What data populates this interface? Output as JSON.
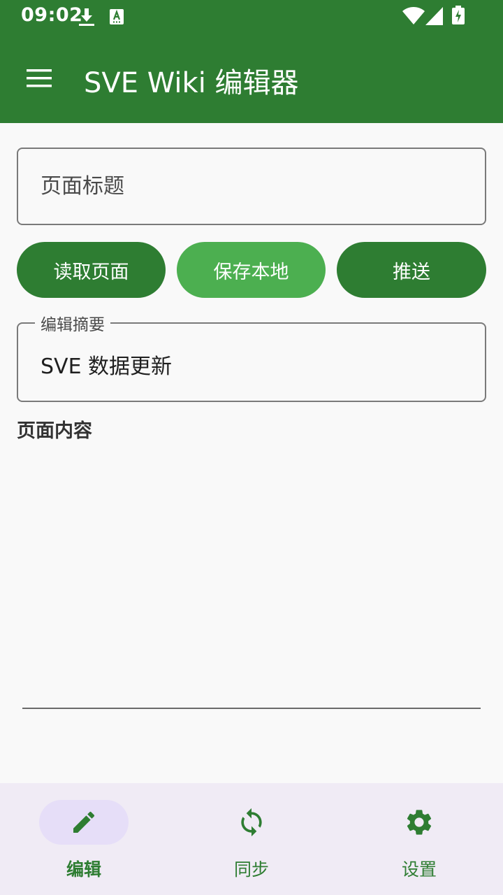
{
  "status_bar": {
    "time": "09:02",
    "icons": [
      "download-icon",
      "keyboard-a-icon",
      "wifi-icon",
      "signal-icon",
      "battery-charging-icon"
    ]
  },
  "app_bar": {
    "menu_icon": "hamburger-menu-icon",
    "title": "SVE Wiki 编辑器"
  },
  "editor": {
    "title_placeholder": "页面标题",
    "title_value": "",
    "buttons": {
      "read": "读取页面",
      "save": "保存本地",
      "push": "推送"
    },
    "summary_label": "编辑摘要",
    "summary_value": "SVE 数据更新",
    "content_label": "页面内容",
    "content_value": ""
  },
  "bottom_nav": {
    "items": [
      {
        "label": "编辑",
        "icon": "pencil-icon",
        "active": true
      },
      {
        "label": "同步",
        "icon": "sync-icon",
        "active": false
      },
      {
        "label": "设置",
        "icon": "gear-icon",
        "active": false
      }
    ]
  },
  "colors": {
    "primary": "#2e7d32",
    "primary_light": "#4caf50",
    "nav_background": "#f0ebf5",
    "nav_indicator": "#e6def8"
  }
}
